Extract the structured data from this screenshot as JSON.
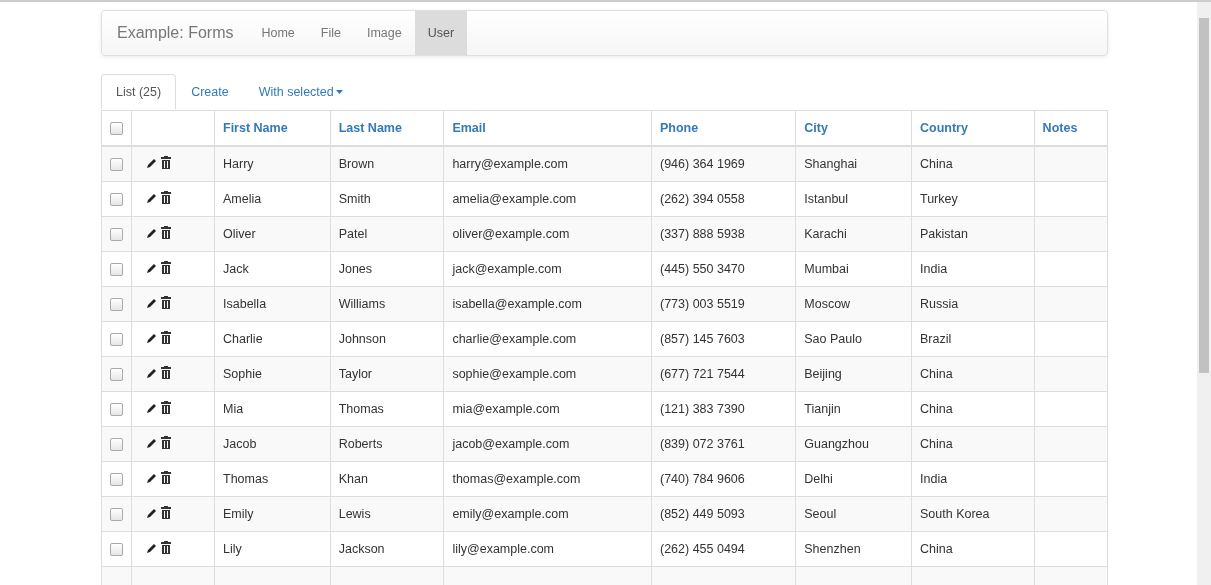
{
  "navbar": {
    "brand": "Example: Forms",
    "items": [
      {
        "label": "Home",
        "selected": false
      },
      {
        "label": "File",
        "selected": false
      },
      {
        "label": "Image",
        "selected": false
      },
      {
        "label": "User",
        "selected": true
      }
    ]
  },
  "tabs": [
    {
      "label": "List (25)",
      "selected": true,
      "kind": "tab"
    },
    {
      "label": "Create",
      "selected": false,
      "kind": "tab"
    },
    {
      "label": "With selected",
      "selected": false,
      "kind": "dropdown"
    }
  ],
  "table": {
    "select_all": {
      "checked": false
    },
    "columns": [
      "First Name",
      "Last Name",
      "Email",
      "Phone",
      "City",
      "Country",
      "Notes"
    ],
    "rows": [
      {
        "checked": false,
        "cells": [
          "Harry",
          "Brown",
          "harry@example.com",
          "(946) 364 1969",
          "Shanghai",
          "China",
          ""
        ]
      },
      {
        "checked": false,
        "cells": [
          "Amelia",
          "Smith",
          "amelia@example.com",
          "(262) 394 0558",
          "Istanbul",
          "Turkey",
          ""
        ]
      },
      {
        "checked": false,
        "cells": [
          "Oliver",
          "Patel",
          "oliver@example.com",
          "(337) 888 5938",
          "Karachi",
          "Pakistan",
          ""
        ]
      },
      {
        "checked": false,
        "cells": [
          "Jack",
          "Jones",
          "jack@example.com",
          "(445) 550 3470",
          "Mumbai",
          "India",
          ""
        ]
      },
      {
        "checked": false,
        "cells": [
          "Isabella",
          "Williams",
          "isabella@example.com",
          "(773) 003 5519",
          "Moscow",
          "Russia",
          ""
        ]
      },
      {
        "checked": false,
        "cells": [
          "Charlie",
          "Johnson",
          "charlie@example.com",
          "(857) 145 7603",
          "Sao Paulo",
          "Brazil",
          ""
        ]
      },
      {
        "checked": false,
        "cells": [
          "Sophie",
          "Taylor",
          "sophie@example.com",
          "(677) 721 7544",
          "Beijing",
          "China",
          ""
        ]
      },
      {
        "checked": false,
        "cells": [
          "Mia",
          "Thomas",
          "mia@example.com",
          "(121) 383 7390",
          "Tianjin",
          "China",
          ""
        ]
      },
      {
        "checked": false,
        "cells": [
          "Jacob",
          "Roberts",
          "jacob@example.com",
          "(839) 072 3761",
          "Guangzhou",
          "China",
          ""
        ]
      },
      {
        "checked": false,
        "cells": [
          "Thomas",
          "Khan",
          "thomas@example.com",
          "(740) 784 9606",
          "Delhi",
          "India",
          ""
        ]
      },
      {
        "checked": false,
        "cells": [
          "Emily",
          "Lewis",
          "emily@example.com",
          "(852) 449 5093",
          "Seoul",
          "South Korea",
          ""
        ]
      },
      {
        "checked": false,
        "cells": [
          "Lily",
          "Jackson",
          "lily@example.com",
          "(262) 455 0494",
          "Shenzhen",
          "China",
          ""
        ]
      }
    ]
  }
}
